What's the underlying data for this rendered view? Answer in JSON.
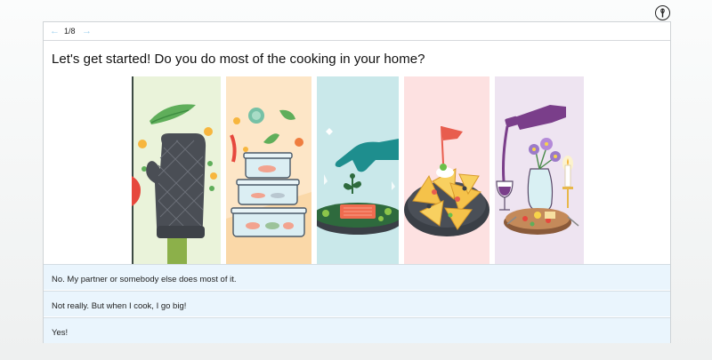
{
  "pager": {
    "prev_icon": "arrow-left-icon",
    "next_icon": "arrow-right-icon",
    "count": "1/8"
  },
  "question": "Let's get started! Do you do most of the cooking in your home?",
  "illustrations": [
    {
      "name": "oven-mitt-illustration",
      "background": "#eaf3da"
    },
    {
      "name": "food-containers-illustration",
      "background": "#fde6c7"
    },
    {
      "name": "salmon-plating-illustration",
      "background": "#c9e8ea"
    },
    {
      "name": "nachos-illustration",
      "background": "#fde1e1"
    },
    {
      "name": "wine-and-flowers-illustration",
      "background": "#eee4f1"
    }
  ],
  "answers": [
    {
      "label": "No. My partner or somebody else does most of it."
    },
    {
      "label": "Not really. But when I cook, I go big!"
    },
    {
      "label": "Yes!"
    }
  ],
  "colors": {
    "answer_bg": "#eaf5fd",
    "arrow": "#9fd0ee"
  }
}
